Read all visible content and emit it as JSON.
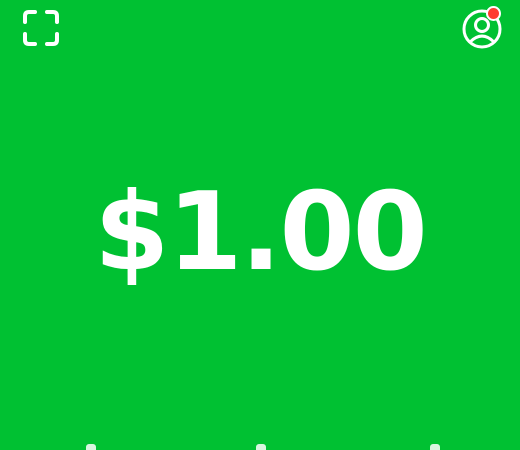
{
  "app": {
    "background_color": "#00c132",
    "accent_color": "#ffffff",
    "notification_color": "#ff3b30"
  },
  "header": {
    "scan_icon": "qr-scanner-icon",
    "profile_icon": "profile-icon",
    "has_notification": true
  },
  "main": {
    "amount": "$1.00"
  }
}
